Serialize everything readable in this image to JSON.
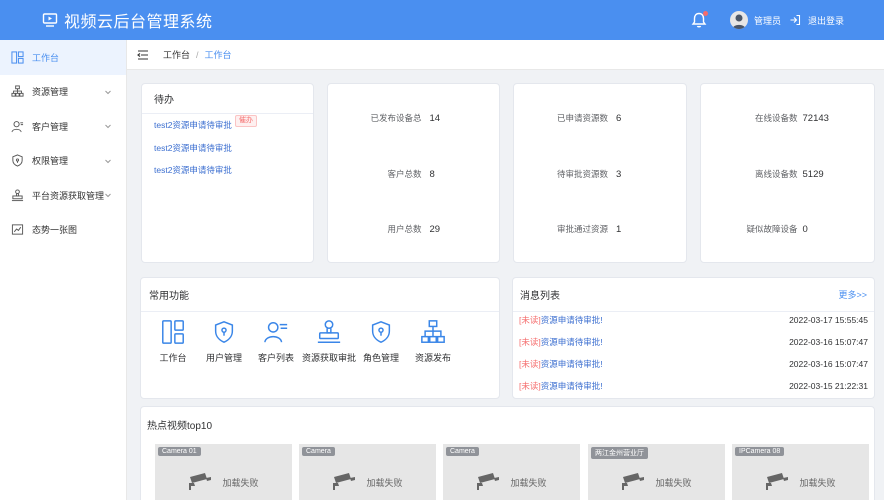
{
  "app": {
    "title": "视频云后台管理系统"
  },
  "header": {
    "user_name": "管理员",
    "logout_label": "退出登录"
  },
  "sidebar": {
    "items": [
      {
        "label": "工作台",
        "icon": "dashboard-icon",
        "active": true,
        "has_children": false
      },
      {
        "label": "资源管理",
        "icon": "resource-icon",
        "active": false,
        "has_children": true
      },
      {
        "label": "客户管理",
        "icon": "customer-icon",
        "active": false,
        "has_children": true
      },
      {
        "label": "权限管理",
        "icon": "permission-icon",
        "active": false,
        "has_children": true
      },
      {
        "label": "平台资源获取管理",
        "icon": "platform-icon",
        "active": false,
        "has_children": true
      },
      {
        "label": "态势一张图",
        "icon": "situation-icon",
        "active": false,
        "has_children": false
      }
    ]
  },
  "breadcrumb": {
    "home": "工作台",
    "separator": "/",
    "current": "工作台"
  },
  "todo": {
    "title": "待办",
    "items": [
      {
        "text": "test2资源申请待审批",
        "badge": "催办"
      },
      {
        "text": "test2资源申请待审批",
        "badge": ""
      },
      {
        "text": "test2资源申请待审批",
        "badge": ""
      }
    ]
  },
  "stats": {
    "group1": [
      {
        "label": "已发布设备总",
        "value": "14"
      },
      {
        "label": "客户总数",
        "value": "8"
      },
      {
        "label": "用户总数",
        "value": "29"
      }
    ],
    "group2": [
      {
        "label": "已申请资源数",
        "value": "6"
      },
      {
        "label": "待审批资源数",
        "value": "3"
      },
      {
        "label": "审批通过资源",
        "value": "1"
      }
    ],
    "group3": [
      {
        "label": "在线设备数",
        "value": "72143"
      },
      {
        "label": "离线设备数",
        "value": "5129"
      },
      {
        "label": "疑似故障设备",
        "value": "0"
      }
    ]
  },
  "functions": {
    "title": "常用功能",
    "items": [
      {
        "label": "工作台",
        "icon": "dashboard-icon"
      },
      {
        "label": "用户管理",
        "icon": "user-shield-icon"
      },
      {
        "label": "客户列表",
        "icon": "customer-list-icon"
      },
      {
        "label": "资源获取审批",
        "icon": "stamp-icon"
      },
      {
        "label": "角色管理",
        "icon": "role-shield-icon"
      },
      {
        "label": "资源发布",
        "icon": "publish-tree-icon"
      }
    ]
  },
  "messages": {
    "title": "消息列表",
    "more_label": "更多>>",
    "items": [
      {
        "tag": "[未读]",
        "text": "资源申请待审批!",
        "time": "2022-03-17 15:55:45"
      },
      {
        "tag": "[未读]",
        "text": "资源申请待审批!",
        "time": "2022-03-16 15:07:47"
      },
      {
        "tag": "[未读]",
        "text": "资源申请待审批!",
        "time": "2022-03-16 15:07:47"
      },
      {
        "tag": "[未读]",
        "text": "资源申请待审批!",
        "time": "2022-03-15 21:22:31"
      }
    ]
  },
  "videos": {
    "title": "热点视频top10",
    "fail_label": "加载失败",
    "items": [
      {
        "camera": "Camera 01"
      },
      {
        "camera": "Camera"
      },
      {
        "camera": "Camera"
      },
      {
        "camera": "两江金州营业厅"
      },
      {
        "camera": "IPCamera 08"
      }
    ]
  },
  "colors": {
    "primary": "#4a8ff0",
    "link": "#3c6fd0",
    "danger": "#f56c6c",
    "background": "#f0f2f5"
  }
}
